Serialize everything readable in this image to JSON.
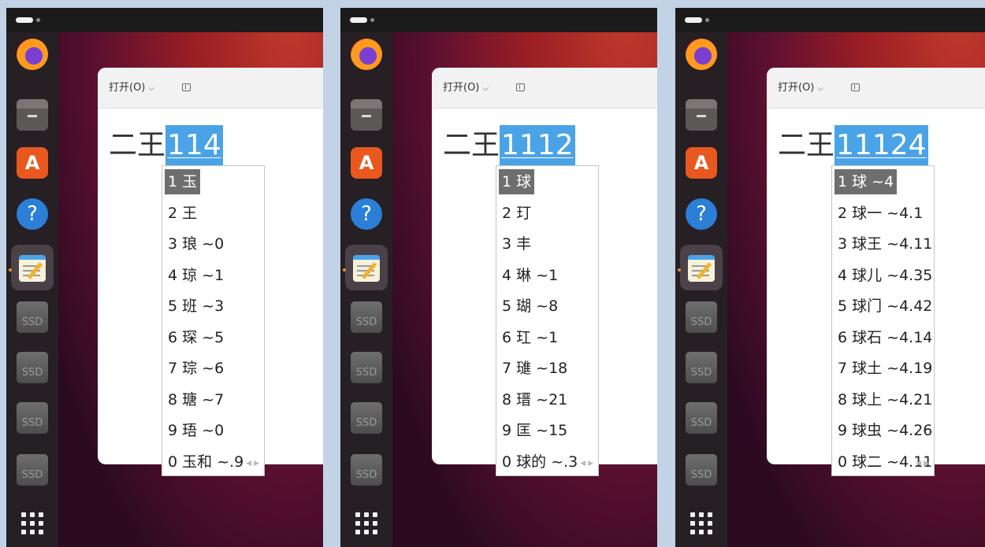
{
  "panels": [
    {
      "window": {
        "open_menu": "打开(O)"
      },
      "editor": {
        "committed": "二王",
        "composing": "114"
      },
      "candidates": [
        "1 玉",
        "2 王",
        "3 琅 ~0",
        "4 琼 ~1",
        "5 班 ~3",
        "6 琛 ~5",
        "7 琮 ~6",
        "8 瑭 ~7",
        "9 珸 ~0",
        "0 玉和 ~.9"
      ],
      "selected_index": 0
    },
    {
      "window": {
        "open_menu": "打开(O)"
      },
      "editor": {
        "committed": "二王",
        "composing": "1112"
      },
      "candidates": [
        "1 球",
        "2 玎",
        "3 丰",
        "4 琳 ~1",
        "5 瑚 ~8",
        "6 玒 ~1",
        "7 璡 ~18",
        "8 瑨 ~21",
        "9 匡 ~15",
        "0 球的 ~.3"
      ],
      "selected_index": 0
    },
    {
      "window": {
        "open_menu": "打开(O)"
      },
      "editor": {
        "committed": "二王",
        "composing": "11124"
      },
      "candidates": [
        "1 球 ~4",
        "2 球一 ~4.1",
        "3 球王 ~4.11",
        "4 球儿 ~4.35",
        "5 球门 ~4.42",
        "6 球石 ~4.14",
        "7 球土 ~4.19",
        "8 球上 ~4.21",
        "9 球虫 ~4.26",
        "0 球二 ~4.11"
      ],
      "selected_index": 0
    }
  ],
  "dock": {
    "items": [
      "firefox-icon",
      "files-icon",
      "app-store-icon",
      "help-icon",
      "text-editor-icon",
      "ssd-drive-icon",
      "ssd-drive-icon",
      "ssd-drive-icon",
      "ssd-drive-icon",
      "show-apps-icon"
    ],
    "drive_label": "SSD",
    "active_item": "text-editor-icon"
  },
  "colors": {
    "composition_highlight": "#4aa3e6",
    "selected_candidate": "#6e6e6e",
    "running_indicator": "#f08a24"
  }
}
